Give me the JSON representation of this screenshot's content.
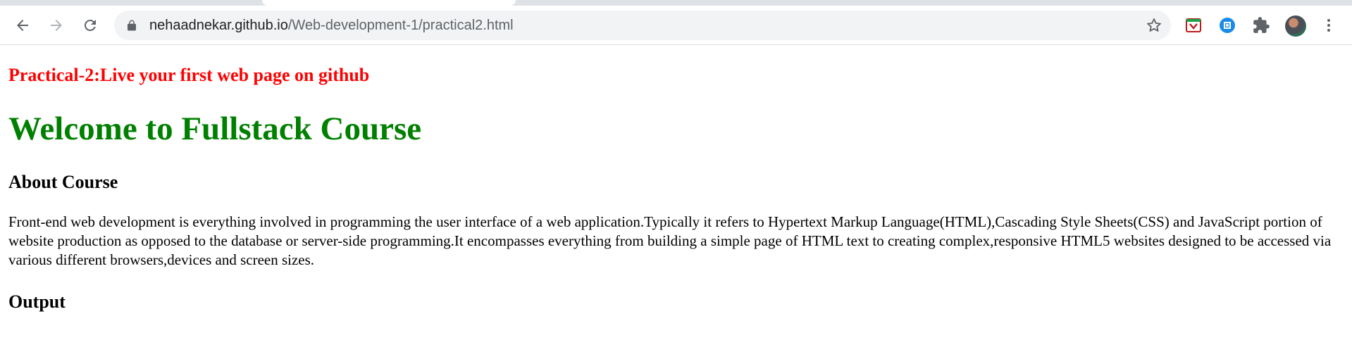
{
  "browser": {
    "url_host": "nehaadnekar.github.io",
    "url_path": "/Web-development-1/practical2.html"
  },
  "colors": {
    "practical_heading": "#ff0000",
    "main_heading": "#008000"
  },
  "icons": {
    "back": "arrow-left-icon",
    "forward": "arrow-right-icon",
    "reload": "reload-icon",
    "lock": "lock-icon",
    "bookmark": "star-icon",
    "extension_1": "mcafee-extension-icon",
    "extension_2": "blue-extension-icon",
    "extensions_menu": "puzzle-icon",
    "menu": "kebab-menu-icon"
  },
  "page": {
    "practical_title": "Practical-2:Live your first web page on github",
    "main_heading": "Welcome to Fullstack Course",
    "about_heading": "About Course",
    "about_text": "Front-end web development is everything involved in programming the user interface of a web application.Typically it refers to Hypertext Markup Language(HTML),Cascading Style Sheets(CSS) and JavaScript portion of website production as opposed to the database or server-side programming.It encompasses everything from building a simple page of HTML text to creating complex,responsive HTML5 websites designed to be accessed via various different browsers,devices and screen sizes.",
    "output_heading": "Output"
  }
}
